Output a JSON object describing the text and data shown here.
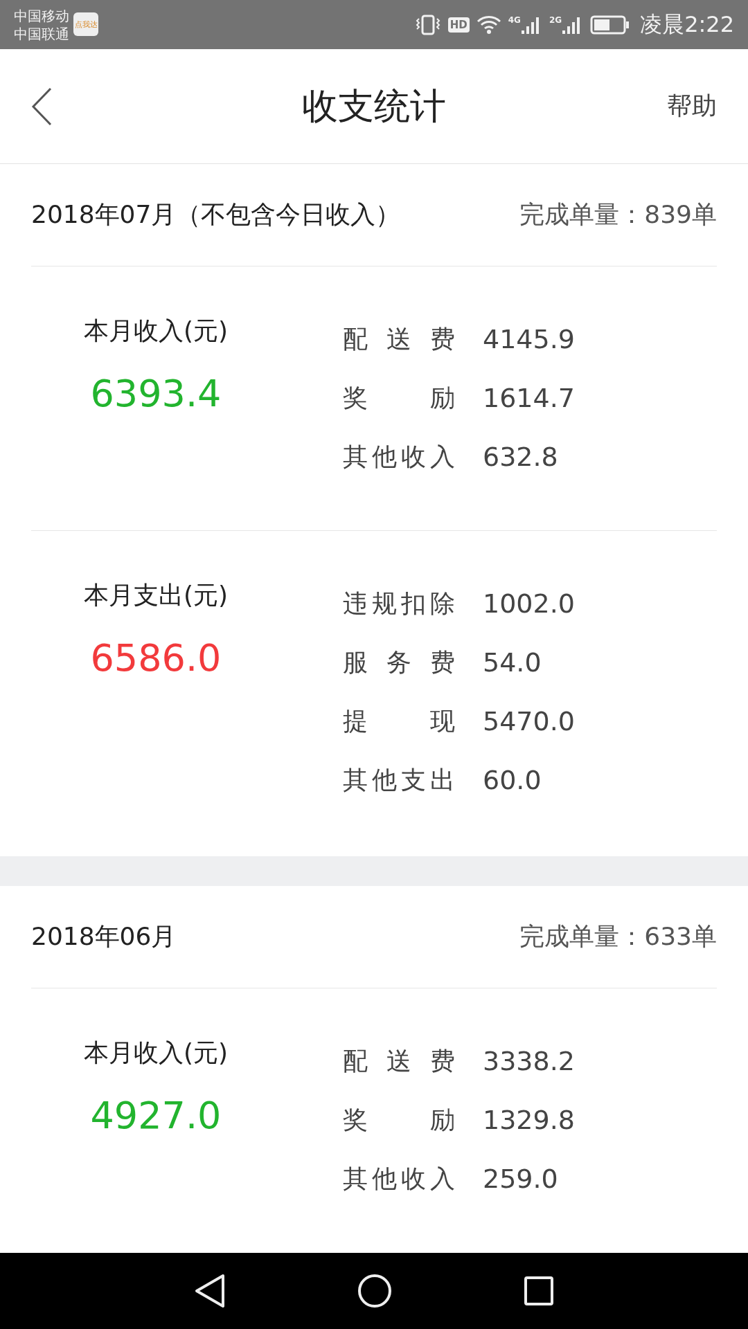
{
  "status_bar": {
    "carriers": [
      "中国移动",
      "中国联通"
    ],
    "app_icon_label": "点我达",
    "hd_label": "HD",
    "networks": [
      "4G",
      "2G"
    ],
    "time": "凌晨2:22"
  },
  "header": {
    "title": "收支统计",
    "help": "帮助"
  },
  "months": [
    {
      "title": "2018年07月（不包含今日收入）",
      "orders": "完成单量：839单",
      "blocks": [
        {
          "kind": "income",
          "label": "本月收入(元)",
          "total": "6393.4",
          "items": [
            {
              "label": "配送费",
              "value": "4145.9"
            },
            {
              "label": "奖励",
              "value": "1614.7"
            },
            {
              "label": "其他收入",
              "value": "632.8"
            }
          ]
        },
        {
          "kind": "expense",
          "label": "本月支出(元)",
          "total": "6586.0",
          "items": [
            {
              "label": "违规扣除",
              "value": "1002.0"
            },
            {
              "label": "服务费",
              "value": "54.0"
            },
            {
              "label": "提现",
              "value": "5470.0"
            },
            {
              "label": "其他支出",
              "value": "60.0"
            }
          ]
        }
      ]
    },
    {
      "title": "2018年06月",
      "orders": "完成单量：633单",
      "blocks": [
        {
          "kind": "income",
          "label": "本月收入(元)",
          "total": "4927.0",
          "items": [
            {
              "label": "配送费",
              "value": "3338.2"
            },
            {
              "label": "奖励",
              "value": "1329.8"
            },
            {
              "label": "其他收入",
              "value": "259.0"
            }
          ]
        }
      ]
    }
  ]
}
